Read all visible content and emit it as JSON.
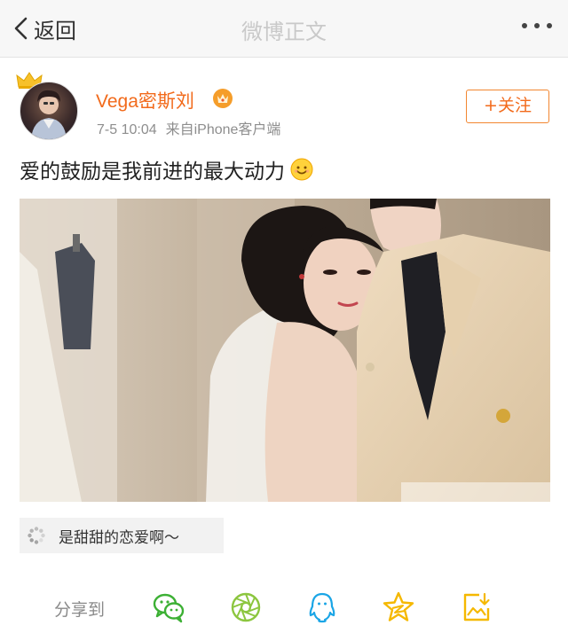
{
  "nav": {
    "back_label": "返回",
    "title": "微博正文"
  },
  "post": {
    "username": "Vega密斯刘",
    "time": "7-5 10:04",
    "source": "来自iPhone客户端",
    "follow_label": "+关注",
    "text": "爱的鼓励是我前进的最大动力"
  },
  "topic": {
    "label": "是甜甜的恋爱啊～"
  },
  "share": {
    "label": "分享到",
    "icons": [
      "wechat-icon",
      "moments-icon",
      "qq-icon",
      "qzone-icon",
      "save-image-icon"
    ]
  },
  "colors": {
    "accent": "#f26a1b",
    "nav_background": "#f7f7f7",
    "wechat_green": "#3cb034",
    "moments_green": "#8cc63f",
    "qq_blue": "#1aa5e6",
    "qzone_yellow": "#f5b800"
  }
}
